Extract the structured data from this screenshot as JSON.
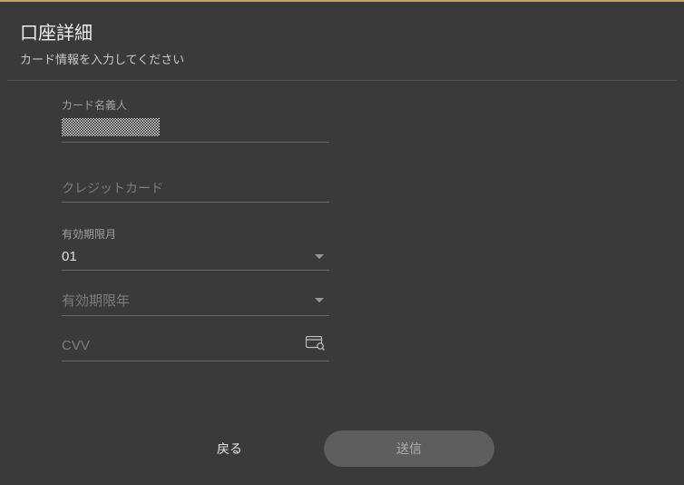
{
  "header": {
    "title": "口座詳細",
    "subtitle": "カード情報を入力してください"
  },
  "form": {
    "cardholder": {
      "label": "カード名義人",
      "value": "██████"
    },
    "cardnumber": {
      "placeholder": "クレジットカード"
    },
    "exp_month": {
      "label": "有効期限月",
      "value": "01"
    },
    "exp_year": {
      "placeholder": "有効期限年"
    },
    "cvv": {
      "placeholder": "CVV"
    }
  },
  "buttons": {
    "back": "戻る",
    "submit": "送信"
  }
}
